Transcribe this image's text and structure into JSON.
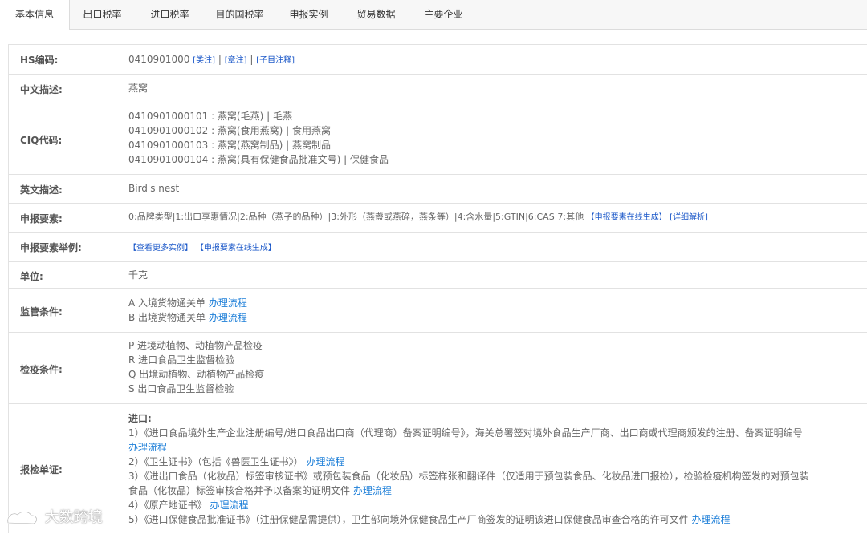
{
  "tabs": [
    "基本信息",
    "出口税率",
    "进口税率",
    "目的国税率",
    "申报实例",
    "贸易数据",
    "主要企业"
  ],
  "hs": {
    "label": "HS编码:",
    "code": "0410901000",
    "links": [
      "[类注]",
      "[章注]",
      "[子目注释]"
    ],
    "sep": "|"
  },
  "cn_desc": {
    "label": "中文描述:",
    "value": "燕窝"
  },
  "ciq": {
    "label": "CIQ代码:",
    "lines": [
      "0410901000101 : 燕窝(毛燕) | 毛燕",
      "0410901000102 : 燕窝(食用燕窝) | 食用燕窝",
      "0410901000103 : 燕窝(燕窝制品) | 燕窝制品",
      "0410901000104 : 燕窝(具有保健食品批准文号) | 保健食品"
    ]
  },
  "en_desc": {
    "label": "英文描述:",
    "value": "Bird's nest"
  },
  "elements": {
    "label": "申报要素:",
    "value": "0:品牌类型|1:出口享惠情况|2:品种（燕子的品种）|3:外形（燕盏或燕碎，燕条等）|4:含水量|5:GTIN|6:CAS|7:其他",
    "link1": "【申报要素在线生成】",
    "link2": "[详细解析]"
  },
  "examples": {
    "label": "申报要素举例:",
    "link1": "【查看更多实例】",
    "link2": "【申报要素在线生成】"
  },
  "unit": {
    "label": "单位:",
    "value": "千克"
  },
  "supervision": {
    "label": "监管条件:",
    "items": [
      {
        "text": "A 入境货物通关单",
        "link": "办理流程"
      },
      {
        "text": "B 出境货物通关单",
        "link": "办理流程"
      }
    ]
  },
  "quarantine": {
    "label": "检疫条件:",
    "items": [
      "P 进境动植物、动植物产品检疫",
      "R 进口食品卫生监督检验",
      "Q 出境动植物、动植物产品检疫",
      "S 出口食品卫生监督检验"
    ]
  },
  "inspection_docs": {
    "label": "报检单证:",
    "heading": "进口:",
    "l1": "1）《进口食品境外生产企业注册编号/进口食品出口商（代理商）备案证明编号》，海关总署签对境外食品生产厂商、出口商或代理商颁发的注册、备案证明编号",
    "l2_link": "办理流程",
    "l3": "2）《卫生证书》（包括《兽医卫生证书》）",
    "l3_link": "办理流程",
    "l4": "3）《进出口食品（化妆品）标签审核证书》或预包装食品（化妆品）标签样张和翻译件（仅适用于预包装食品、化妆品进口报检），检验检疫机构签发的对预包装",
    "l5": "食品（化妆品）标签审核合格并予以备案的证明文件",
    "l5_link": "办理流程",
    "l6": "4）《原产地证书》",
    "l6_link": "办理流程",
    "l7": "5）《进口保健食品批准证书》（注册保健品需提供），卫生部向境外保健食品生产厂商签发的证明该进口保健食品审查合格的许可文件",
    "l7_link": "办理流程"
  },
  "watermark": "大数跨境"
}
